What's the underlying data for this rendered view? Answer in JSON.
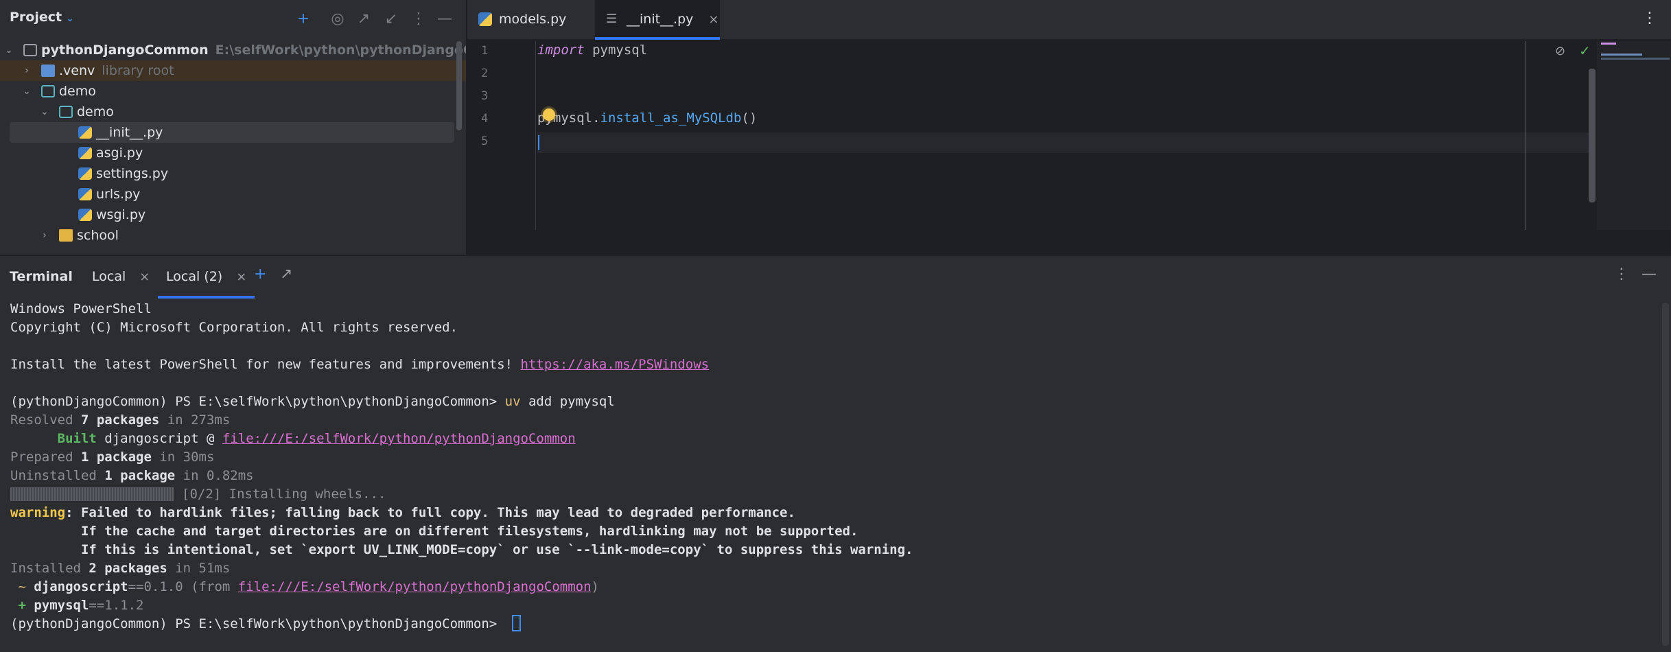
{
  "project": {
    "title": "Project",
    "tree": [
      {
        "label": "pythonDjangoCommon",
        "hint": "E:\\selfWork\\python\\pythonDjangoCommon"
      },
      {
        "label": ".venv",
        "hint": "library root"
      },
      {
        "label": "demo"
      },
      {
        "label": "demo"
      },
      {
        "label": "__init__.py"
      },
      {
        "label": "asgi.py"
      },
      {
        "label": "settings.py"
      },
      {
        "label": "urls.py"
      },
      {
        "label": "wsgi.py"
      },
      {
        "label": "school"
      }
    ]
  },
  "editor": {
    "tabs": [
      {
        "label": "models.py"
      },
      {
        "label": "__init__.py"
      }
    ],
    "line_numbers": [
      "1",
      "2",
      "3",
      "4",
      "5"
    ],
    "code": {
      "line1_kw": "import",
      "line1_rest": " pymysql",
      "line4_obj": "pymysql.",
      "line4_fn": "install_as_MySQLdb",
      "line4_end": "()"
    }
  },
  "terminal": {
    "title": "Terminal",
    "tabs": [
      {
        "label": "Local"
      },
      {
        "label": "Local (2)"
      }
    ],
    "lines": {
      "l1": "Windows PowerShell",
      "l2": "Copyright (C) Microsoft Corporation. All rights reserved.",
      "l4_text": "Install the latest PowerShell for new features and improvements! ",
      "l4_link": "https://aka.ms/PSWindows",
      "prompt": "(pythonDjangoCommon) PS E:\\selfWork\\python\\pythonDjangoCommon> ",
      "l6_cmd": "uv",
      "l6_args": " add pymysql",
      "l7_a": "Resolved ",
      "l7_b": "7 packages",
      "l7_c": " in 273ms",
      "l8_a": "      Built",
      "l8_b": " djangoscript @ ",
      "l8_link": "file:///E:/selfWork/python/pythonDjangoCommon",
      "l9_a": "Prepared ",
      "l9_b": "1 package",
      "l9_c": " in 30ms",
      "l10_a": "Uninstalled ",
      "l10_b": "1 package",
      "l10_c": " in 0.82ms",
      "l11": "[0/2] Installing wheels...",
      "l12_a": "warning",
      "l12_b": ": Failed to hardlink files; falling back to full copy. This may lead to degraded performance.",
      "l13": "         If the cache and target directories are on different filesystems, hardlinking may not be supported.",
      "l14": "         If this is intentional, set `export UV_LINK_MODE=copy` or use `--link-mode=copy` to suppress this warning.",
      "l15_a": "Installed ",
      "l15_b": "2 packages",
      "l15_c": " in 51ms",
      "l16_a": " ~ ",
      "l16_b": "djangoscript",
      "l16_c": "==0.1.0 (from ",
      "l16_link": "file:///E:/selfWork/python/pythonDjangoCommon",
      "l16_d": ")",
      "l17_a": " + ",
      "l17_b": "pymysql",
      "l17_c": "==1.1.2"
    }
  },
  "colors": {
    "accent": "#3574f0",
    "background": "#1e1f22",
    "panel": "#2b2d30",
    "keyword": "#cf8ee6",
    "function": "#56a8f5",
    "warning": "#f2c94c",
    "link": "#d96fd1",
    "success": "#5fb865"
  }
}
